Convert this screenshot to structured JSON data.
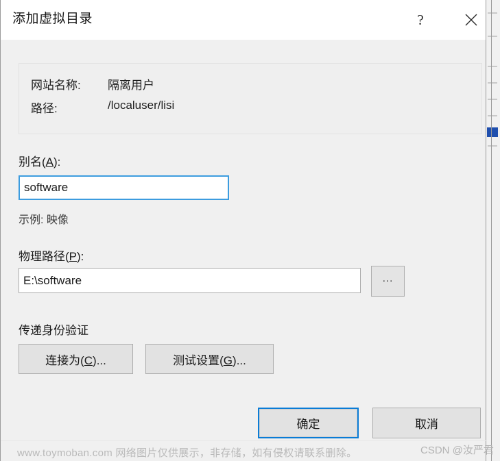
{
  "window": {
    "title": "添加虚拟目录",
    "help_glyph": "?",
    "close_glyph": "✕"
  },
  "info_panel": {
    "site_name_label": "网站名称:",
    "site_name_value": "隔离用户",
    "path_label": "路径:",
    "path_value": "/localuser/lisi"
  },
  "alias": {
    "label_prefix": "别名(",
    "label_accel": "A",
    "label_suffix": "):",
    "value": "software",
    "placeholder": "",
    "hint": "示例: 映像"
  },
  "physical_path": {
    "label_prefix": "物理路径(",
    "label_accel": "P",
    "label_suffix": "):",
    "value": "E:\\software",
    "placeholder": "",
    "browse_label": "..."
  },
  "auth": {
    "heading": "传递身份验证",
    "connect_as_prefix": "连接为(",
    "connect_as_accel": "C",
    "connect_as_suffix": ")...",
    "test_settings_prefix": "测试设置(",
    "test_settings_accel": "G",
    "test_settings_suffix": ")..."
  },
  "footer": {
    "ok_label": "确定",
    "cancel_label": "取消"
  },
  "watermarks": {
    "left": "www.toymoban.com 网络图片仅供展示，非存储，如有侵权请联系删除。",
    "right": "CSDN @汝严君"
  },
  "colors": {
    "dialog_background": "#f0f0f0",
    "titlebar_background": "#ffffff",
    "focus_border": "#3c9cdf",
    "default_button_border": "#0a7cd6",
    "button_face": "#e2e2e2",
    "text": "#1a1a1a",
    "watermark_text": "#b9b9b9"
  }
}
